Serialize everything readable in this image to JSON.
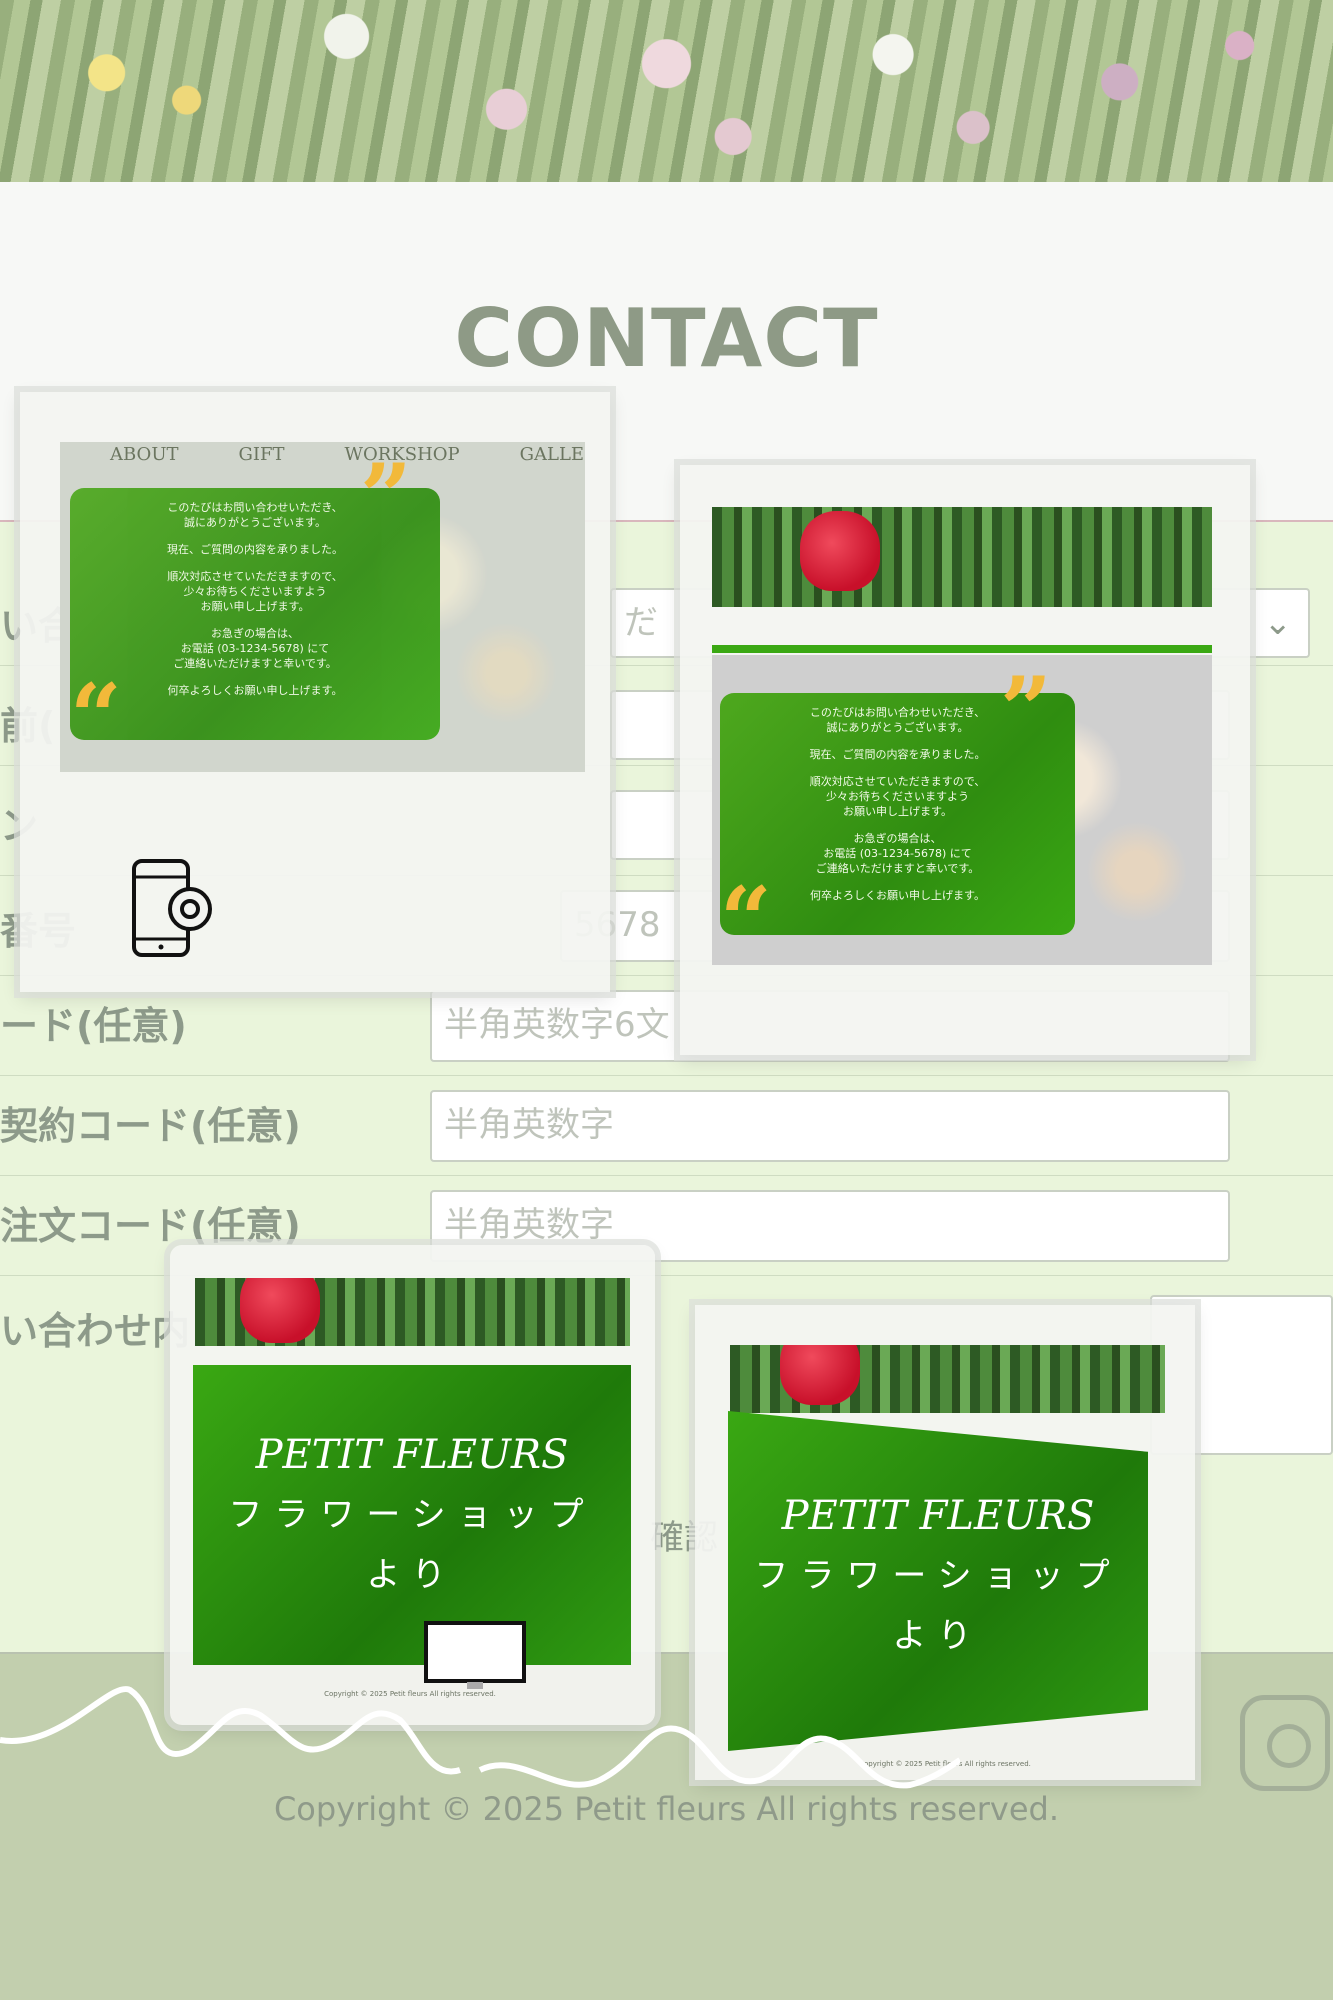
{
  "page": {
    "title": "CONTACT",
    "copyright": "Copyright © 2025 Petit fleurs All rights reserved."
  },
  "nav": [
    "ABOUT",
    "GIFT",
    "WORKSHOP",
    "GALLERY"
  ],
  "form": {
    "rows": [
      {
        "label": "い合",
        "value": "だ"
      },
      {
        "label": "前(",
        "value": ""
      },
      {
        "label": "ン",
        "value": ""
      },
      {
        "label": "番号",
        "value": "5678"
      },
      {
        "label": "ード(任意)",
        "value": "半角英数字6文"
      },
      {
        "label": "契約コード(任意)",
        "value": "半角英数字"
      },
      {
        "label": "注文コード(任意)",
        "value": "半角英数字"
      },
      {
        "label": "い合わせ内",
        "value": ""
      }
    ],
    "confirm_label": "確認"
  },
  "card": {
    "message": [
      "このたびはお問い合わせいただき、",
      "誠にありがとうございます。",
      "",
      "現在、ご質問の内容を承りました。",
      "",
      "順次対応させていただきますので、",
      "少々お待ちくださいますよう",
      "お願い申し上げます。",
      "",
      "お急ぎの場合は、",
      "お電話 (03-1234-5678) にて",
      "ご連絡いただけますと幸いです。",
      "",
      "何卒よろしくお願い申し上げます。"
    ],
    "shop_name": "PETIT FLEURS",
    "shop_sub": "フラワーショップ",
    "shop_from": "より",
    "small_copyright": "Copyright © 2025 Petit fleurs All rights reserved."
  },
  "icons": {
    "settings": "mobile-settings-icon",
    "monitor": "monitor-icon",
    "instagram": "instagram-icon",
    "select": "chevron-down-icon"
  },
  "colors": {
    "accent_green": "#3aa813",
    "quote_yellow": "#f2b93a"
  }
}
